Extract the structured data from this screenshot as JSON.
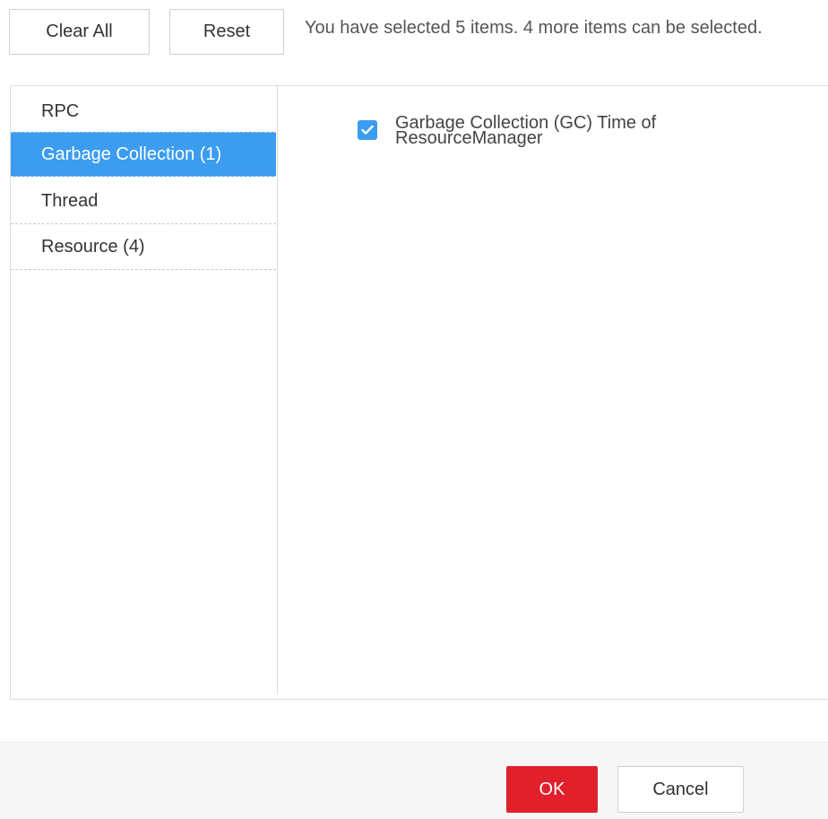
{
  "toolbar": {
    "clear_all_label": "Clear All",
    "reset_label": "Reset",
    "selection_info": "You have selected 5 items. 4 more items can be selected."
  },
  "categories": [
    {
      "label": "RPC",
      "selected": false
    },
    {
      "label": "Garbage Collection (1)",
      "selected": true
    },
    {
      "label": "Thread",
      "selected": false
    },
    {
      "label": "Resource (4)",
      "selected": false
    }
  ],
  "metrics": [
    {
      "label": "Garbage Collection (GC) Time of ResourceManager",
      "checked": true,
      "icon": "checkmark-icon"
    }
  ],
  "footer": {
    "ok_label": "OK",
    "cancel_label": "Cancel"
  },
  "colors": {
    "accent": "#3c9cf0",
    "primary_button": "#e2202c",
    "footer_background": "#f6f6f6"
  }
}
